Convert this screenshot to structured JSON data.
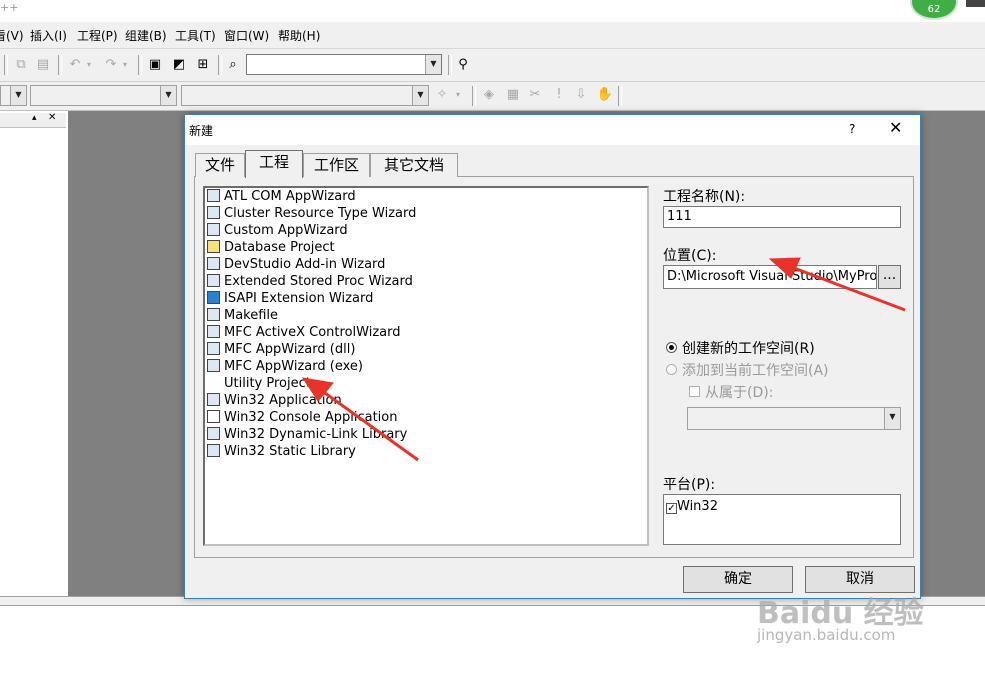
{
  "window": {
    "title_fragment": "++",
    "badge": "62"
  },
  "menu": [
    "看(V)",
    "插入(I)",
    "工程(P)",
    "组建(B)",
    "工具(T)",
    "窗口(W)",
    "帮助(H)"
  ],
  "dialog": {
    "title": "新建",
    "help": "?",
    "close": "✕",
    "tabs": [
      "文件",
      "工程",
      "工作区",
      "其它文档"
    ],
    "active_tab": "工程",
    "projects": [
      "ATL COM AppWizard",
      "Cluster Resource Type Wizard",
      "Custom AppWizard",
      "Database Project",
      "DevStudio Add-in Wizard",
      "Extended Stored Proc Wizard",
      "ISAPI Extension Wizard",
      "Makefile",
      "MFC ActiveX ControlWizard",
      "MFC AppWizard (dll)",
      "MFC AppWizard (exe)",
      "Utility Project",
      "Win32 Application",
      "Win32 Console Application",
      "Win32 Dynamic-Link Library",
      "Win32 Static Library"
    ],
    "project_name_label": "工程名称(N):",
    "project_name_value": "111",
    "location_label": "位置(C):",
    "location_value": "D:\\Microsoft Visual Studio\\MyPro",
    "browse_label": "...",
    "radio_new": "创建新的工作空间(R)",
    "radio_add": "添加到当前工作空间(A)",
    "dependency_label": "从属于(D):",
    "platform_label": "平台(P):",
    "platforms": [
      "Win32"
    ],
    "ok": "确定",
    "cancel": "取消"
  },
  "watermark": {
    "brand": "Baidu 经验",
    "url": "jingyan.baidu.com"
  },
  "colors": {
    "arrow": "#e8332b",
    "mdi_background": "#808080",
    "dialog_border": "#3c7fb1"
  }
}
